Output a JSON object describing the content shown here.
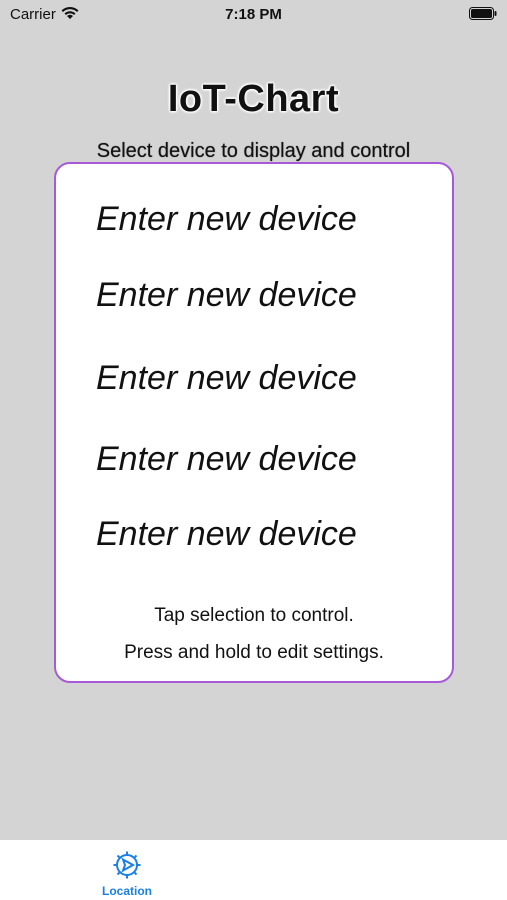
{
  "status_bar": {
    "carrier": "Carrier",
    "time": "7:18 PM"
  },
  "header": {
    "title": "IoT-Chart",
    "subtitle": "Select device to display and control"
  },
  "device_list": {
    "items": [
      {
        "label": "Enter new device"
      },
      {
        "label": "Enter new device"
      },
      {
        "label": "Enter new device"
      },
      {
        "label": "Enter new device"
      },
      {
        "label": "Enter new device"
      }
    ],
    "hint_tap": "Tap selection to control.",
    "hint_hold": "Press and hold to edit settings."
  },
  "tab_bar": {
    "tabs": [
      {
        "label": "Location",
        "icon": "location-gear-icon",
        "active": true
      }
    ]
  },
  "colors": {
    "background": "#d4d4d4",
    "card_border": "#a65ad8",
    "tab_active": "#1a7fe6"
  }
}
